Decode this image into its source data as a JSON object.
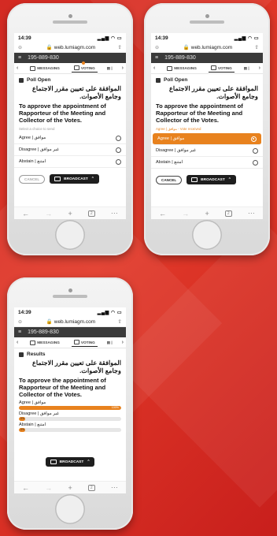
{
  "phones": [
    {
      "time": "14:39",
      "url": "web.lumiagm.com",
      "meeting_id": "195-889-830",
      "tabs": {
        "messaging": "MESSAGING",
        "voting": "VOTING"
      },
      "section": "Poll Open",
      "question_ar": "الموافقة على تعيين مقرر الاجتماع وجامع الأصوات.",
      "question_en": "To approve the appointment of Rapporteur of the Meeting and Collector of the Votes.",
      "hint": "Select a choice to send",
      "options": [
        "Agree | موافق",
        "Disagree | غير موافق",
        "Abstain | امتنع"
      ],
      "cancel": "CANCEL",
      "broadcast": "BROADCAST",
      "tab_count": "2"
    },
    {
      "time": "14:39",
      "url": "web.lumiagm.com",
      "meeting_id": "195-889-830",
      "tabs": {
        "messaging": "MESSAGING",
        "voting": "VOTING"
      },
      "section": "Poll Open",
      "question_ar": "الموافقة على تعيين مقرر الاجتماع وجامع الأصوات.",
      "question_en": "To approve the appointment of Rapporteur of the Meeting and Collector of the Votes.",
      "hint": "Agree | موافق - Vote received",
      "options": [
        "Agree | موافق",
        "Disagree | غير موافق",
        "Abstain | امتنع"
      ],
      "selected_index": 0,
      "cancel": "CANCEL",
      "broadcast": "BROADCAST",
      "tab_count": "2"
    },
    {
      "time": "14:39",
      "url": "web.lumiagm.com",
      "meeting_id": "195-889-830",
      "tabs": {
        "messaging": "MESSAGING",
        "voting": "VOTING"
      },
      "section": "Results",
      "question_ar": "الموافقة على تعيين مقرر الاجتماع وجامع الأصوات.",
      "question_en": "To approve the appointment of Rapporteur of the Meeting and Collector of the Votes.",
      "results": [
        {
          "label": "Agree | موافق",
          "percent": 100,
          "text": "100%"
        },
        {
          "label": "Disagree | غير موافق",
          "percent": 0,
          "text": "0%"
        },
        {
          "label": "Abstain | امتنع",
          "percent": 0,
          "text": "0%"
        }
      ],
      "broadcast": "BROADCAST",
      "tab_count": "2"
    }
  ],
  "colors": {
    "accent": "#e8821e",
    "appbar": "#3a3a3a",
    "background": "#d42a23"
  }
}
